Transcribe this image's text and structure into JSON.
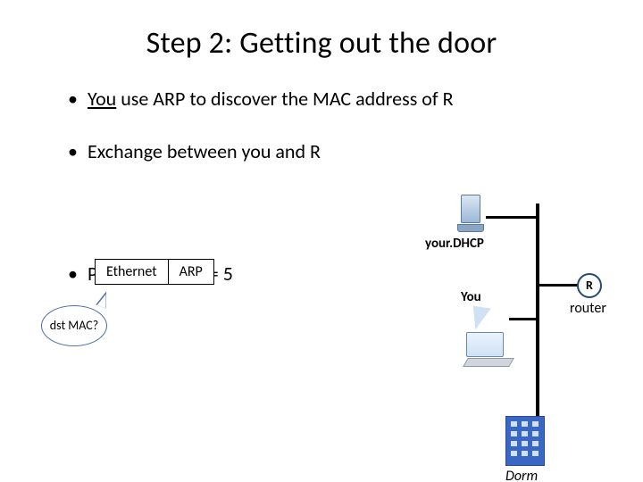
{
  "title": "Step 2: Getting out the door",
  "bullets": {
    "b1_pre": "You",
    "b1_post": " use ARP to discover the MAC address of R",
    "b2": "Exchange between you and R",
    "b3": "Protocol count = 5"
  },
  "pkt": {
    "ethernet": "Ethernet",
    "arp": "ARP"
  },
  "callout": "dst MAC?",
  "net": {
    "dhcp": "your.DHCP",
    "you": "You",
    "r": "R",
    "router": "router",
    "dorm": "Dorm"
  }
}
